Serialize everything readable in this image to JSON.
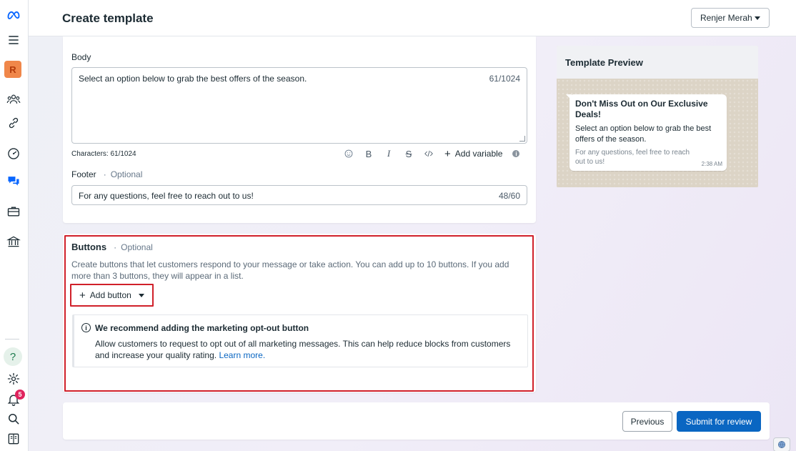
{
  "header": {
    "title": "Create template",
    "account": "Renjer Merah"
  },
  "rail": {
    "avatar_letter": "R",
    "help_glyph": "?",
    "notifications_count": "5",
    "icons": [
      "meta-logo-icon",
      "menu-icon",
      "people-icon",
      "link-icon",
      "dashboard-icon",
      "chat-icon",
      "briefcase-icon",
      "bank-icon",
      "gear-icon",
      "bell-icon",
      "search-icon",
      "book-icon"
    ]
  },
  "body_section": {
    "label": "Body",
    "text": "Select an option below to grab the best offers of the season.",
    "counter": "61/1024",
    "characters_line": "Characters: 61/1024",
    "toolbar": {
      "bold": "B",
      "italic": "I",
      "strike": "S",
      "add_variable": "Add variable"
    }
  },
  "footer_section": {
    "label": "Footer",
    "optional": "Optional",
    "value": "For any questions, feel free to reach out to us!",
    "counter": "48/60"
  },
  "buttons_section": {
    "title": "Buttons",
    "optional": "Optional",
    "description": "Create buttons that let customers respond to your message or take action. You can add up to 10 buttons. If you add more than 3 buttons, they will appear in a list.",
    "add_button": "Add button",
    "recommend": {
      "title": "We recommend adding the marketing opt-out button",
      "text": "Allow customers to request to opt out of all marketing messages. This can help reduce blocks from customers and increase your quality rating.",
      "link": "Learn more."
    }
  },
  "preview": {
    "heading": "Template Preview",
    "title": "Don't Miss Out on Our Exclusive Deals!",
    "body": "Select an option below to grab the best offers of the season.",
    "footer": "For any questions, feel free to reach out to us!",
    "time": "2:38 AM"
  },
  "actions": {
    "previous": "Previous",
    "submit": "Submit for review"
  },
  "colors": {
    "primary": "#0a66c2",
    "highlight": "#d0202a",
    "badge": "#e0245e",
    "avatar": "#f0874a"
  }
}
